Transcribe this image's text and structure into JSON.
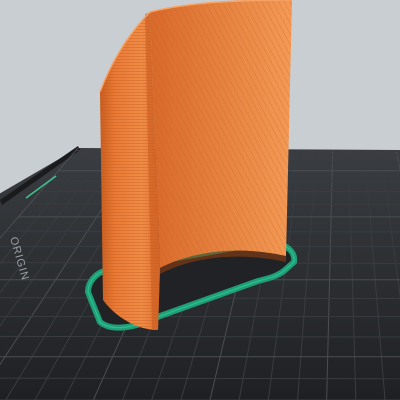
{
  "scene": {
    "background_color": "#c9ced3",
    "bed": {
      "surface_color": "#2b2d30",
      "grid_minor_color": "#393c40",
      "grid_major_color": "#4a4e53",
      "origin_label": "ORIGIN",
      "origin_label_color": "#9aa0a6",
      "logo_marker_color": "#3ec58a"
    },
    "model": {
      "face_color": "#ea7a35",
      "shadow_color": "#c25a1c",
      "highlight_color": "#f59a55",
      "layer_line_color": "#b85318"
    },
    "first_layer": {
      "color": "#1f9e78",
      "edge_color": "#2fc990"
    }
  }
}
